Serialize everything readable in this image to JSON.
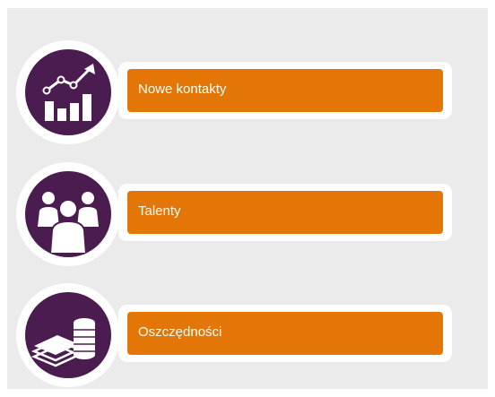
{
  "items": [
    {
      "label": "Nowe kontakty",
      "icon": "growth-chart-icon"
    },
    {
      "label": "Talenty",
      "icon": "people-group-icon"
    },
    {
      "label": "Oszczędności",
      "icon": "coin-stack-icon"
    }
  ],
  "colors": {
    "background": "#ebebeb",
    "icon_circle": "#4a1c4f",
    "accent": "#e47607",
    "text": "#ffffff"
  }
}
